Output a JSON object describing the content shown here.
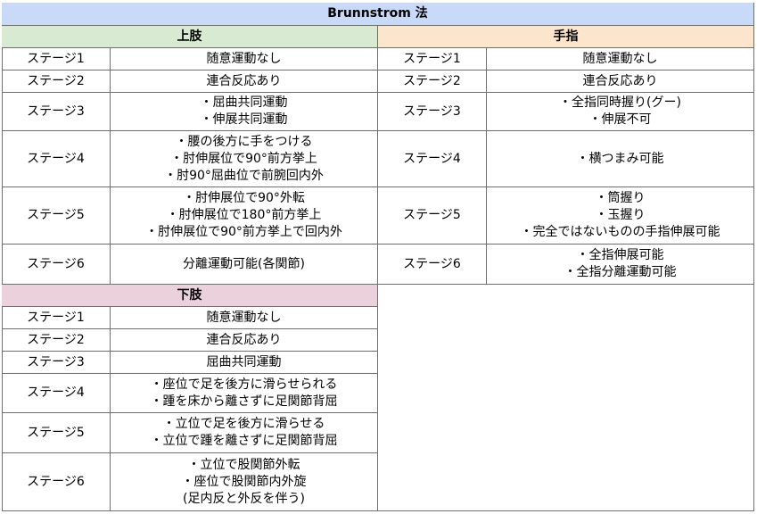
{
  "title": "Brunnstrom 法",
  "upper_limb": {
    "header": "上肢",
    "rows": [
      {
        "stage": "ステージ1",
        "desc": [
          "随意運動なし"
        ]
      },
      {
        "stage": "ステージ2",
        "desc": [
          "連合反応あり"
        ]
      },
      {
        "stage": "ステージ3",
        "desc": [
          "・屈曲共同運動",
          "・伸展共同運動"
        ]
      },
      {
        "stage": "ステージ4",
        "desc": [
          "・腰の後方に手をつける",
          "・肘伸展位で90°前方挙上",
          "・肘90°屈曲位で前腕回内外"
        ]
      },
      {
        "stage": "ステージ5",
        "desc": [
          "・肘伸展位で90°外転",
          "・肘伸展位で180°前方挙上",
          "・肘伸展位で90°前方挙上で回内外"
        ]
      },
      {
        "stage": "ステージ6",
        "desc": [
          "分離運動可能(各関節)"
        ]
      }
    ]
  },
  "fingers": {
    "header": "手指",
    "rows": [
      {
        "stage": "ステージ1",
        "desc": [
          "随意運動なし"
        ]
      },
      {
        "stage": "ステージ2",
        "desc": [
          "連合反応あり"
        ]
      },
      {
        "stage": "ステージ3",
        "desc": [
          "・全指同時握り(グー)",
          "・伸展不可"
        ]
      },
      {
        "stage": "ステージ4",
        "desc": [
          "・横つまみ可能"
        ]
      },
      {
        "stage": "ステージ5",
        "desc": [
          "・筒握り",
          "・玉握り",
          "・完全ではないものの手指伸展可能"
        ]
      },
      {
        "stage": "ステージ6",
        "desc": [
          "・全指伸展可能",
          "・全指分離運動可能"
        ]
      }
    ]
  },
  "lower_limb": {
    "header": "下肢",
    "rows": [
      {
        "stage": "ステージ1",
        "desc": [
          "随意運動なし"
        ]
      },
      {
        "stage": "ステージ2",
        "desc": [
          "連合反応あり"
        ]
      },
      {
        "stage": "ステージ3",
        "desc": [
          "屈曲共同運動"
        ]
      },
      {
        "stage": "ステージ4",
        "desc": [
          "・座位で足を後方に滑らせられる",
          "・踵を床から離さずに足関節背屈"
        ]
      },
      {
        "stage": "ステージ5",
        "desc": [
          "・立位で足を後方に滑らせる",
          "・立位で踵を離さずに足関節背屈"
        ]
      },
      {
        "stage": "ステージ6",
        "desc": [
          "・立位で股関節外転",
          "・座位で股関節内外旋",
          "(足内反と外反を伴う)"
        ]
      }
    ]
  }
}
